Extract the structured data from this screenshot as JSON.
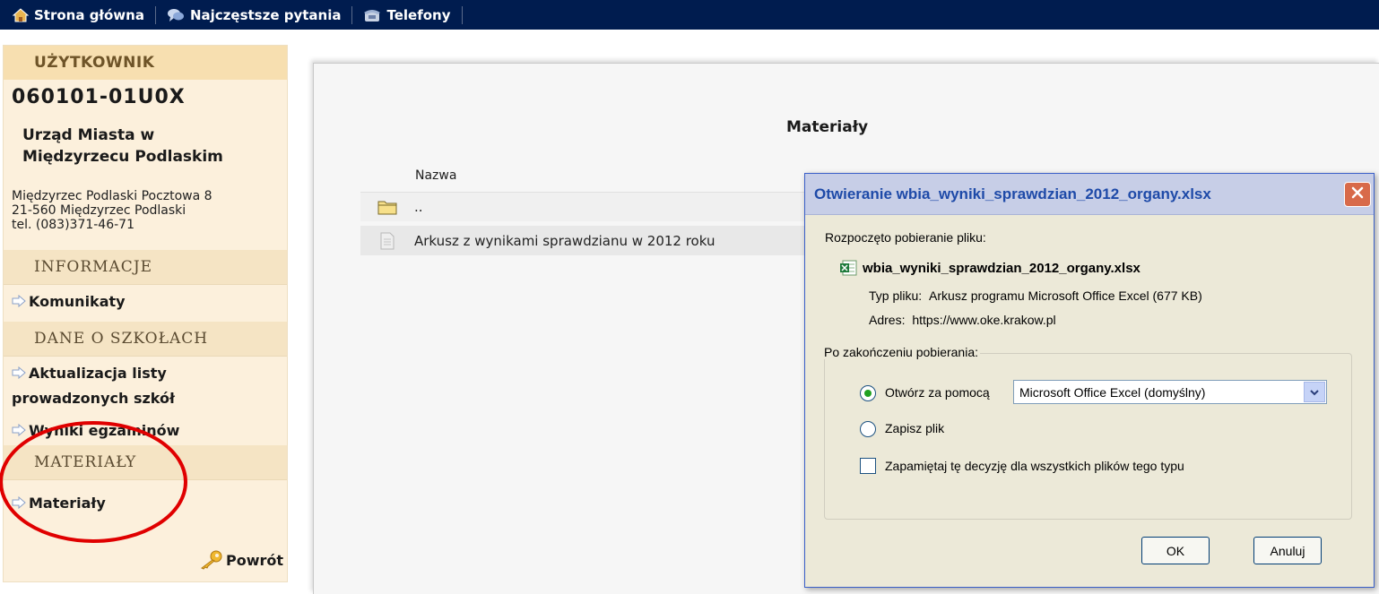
{
  "topnav": {
    "items": [
      {
        "label": "Strona główna",
        "icon": "home-icon"
      },
      {
        "label": "Najczęstsze pytania",
        "icon": "speech-bubble-icon"
      },
      {
        "label": "Telefony",
        "icon": "phone-icon"
      }
    ]
  },
  "sidebar": {
    "user_header": "UŻYTKOWNIK",
    "user_code": "060101-01U0X",
    "org_line1": "Urząd Miasta w",
    "org_line2": "Międzyrzecu Podlaskim",
    "address_line1": "Międzyrzec Podlaski Pocztowa 8",
    "address_line2": "21-560 Międzyrzec Podlaski",
    "address_line3": "tel. (083)371-46-71",
    "sections": [
      {
        "title": "INFORMACJE",
        "links": [
          "Komunikaty"
        ]
      },
      {
        "title": "DANE O SZKOŁACH",
        "links": [
          "Aktualizacja listy prowadzonych szkół",
          "Wyniki egzaminów"
        ]
      },
      {
        "title": "MATERIAŁY",
        "links": [
          "Materiały"
        ]
      }
    ],
    "back_label": "Powrót"
  },
  "main": {
    "title": "Materiały",
    "column_name": "Nazwa",
    "rows": [
      {
        "label": "..",
        "icon": "folder-icon"
      },
      {
        "label": "Arkusz z wynikami sprawdzianu w 2012 roku",
        "icon": "document-icon"
      }
    ]
  },
  "dialog": {
    "title": "Otwieranie wbia_wyniki_sprawdzian_2012_organy.xlsx",
    "started_text": "Rozpoczęto pobieranie pliku:",
    "filename": "wbia_wyniki_sprawdzian_2012_organy.xlsx",
    "type_label": "Typ pliku:",
    "type_value": "Arkusz programu Microsoft Office Excel (677 KB)",
    "address_label": "Adres:",
    "address_value": "https://www.oke.krakow.pl",
    "group_label": "Po zakończeniu pobierania:",
    "open_with_label": "Otwórz za pomocą",
    "open_with_value": "Microsoft Office Excel (domyślny)",
    "save_label": "Zapisz plik",
    "remember_label": "Zapamiętaj tę decyzję dla wszystkich plików tego typu",
    "ok_label": "OK",
    "cancel_label": "Anuluj",
    "selected_option": "open"
  },
  "colors": {
    "topbar": "#001c4f",
    "sidebar_bg": "#fcf0dc",
    "section_header": "#f7dfb0",
    "annotation": "#e00000",
    "dialog_title": "#1e4aa8"
  }
}
